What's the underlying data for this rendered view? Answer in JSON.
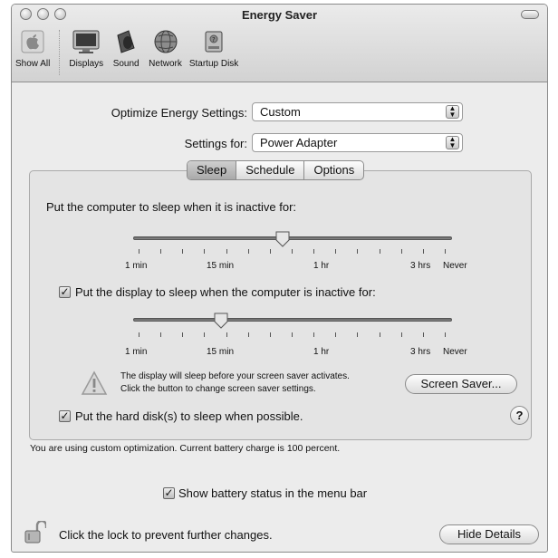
{
  "window": {
    "title": "Energy Saver"
  },
  "toolbar": {
    "items": [
      {
        "label": "Show All",
        "icon": "apple-icon"
      },
      {
        "label": "Displays",
        "icon": "display-icon"
      },
      {
        "label": "Sound",
        "icon": "speaker-icon"
      },
      {
        "label": "Network",
        "icon": "globe-icon"
      },
      {
        "label": "Startup Disk",
        "icon": "disk-icon"
      }
    ]
  },
  "settings": {
    "optimize_label": "Optimize Energy Settings:",
    "optimize_value": "Custom",
    "settings_for_label": "Settings for:",
    "settings_for_value": "Power Adapter"
  },
  "tabs": [
    "Sleep",
    "Schedule",
    "Options"
  ],
  "sleep": {
    "computer_label": "Put the computer to sleep when it is inactive for:",
    "computer_slider_value": "35 min",
    "display_checked": true,
    "display_label": "Put the display to sleep when the computer is inactive for:",
    "display_slider_value": "20 min",
    "scale_labels": [
      "1 min",
      "15 min",
      "1 hr",
      "3 hrs",
      "Never"
    ],
    "warning_line1": "The display will sleep before your screen saver activates.",
    "warning_line2": "Click the button to change screen saver settings.",
    "screen_saver_button": "Screen Saver...",
    "hard_disk_checked": true,
    "hard_disk_label": "Put the hard disk(s) to sleep when possible.",
    "help_label": "?"
  },
  "status_text": "You are using custom optimization. Current battery charge is 100 percent.",
  "battery_status": {
    "checked": true,
    "label": "Show battery status in the menu bar"
  },
  "footer": {
    "lock_text": "Click the lock to prevent further changes.",
    "hide_details_button": "Hide Details"
  }
}
